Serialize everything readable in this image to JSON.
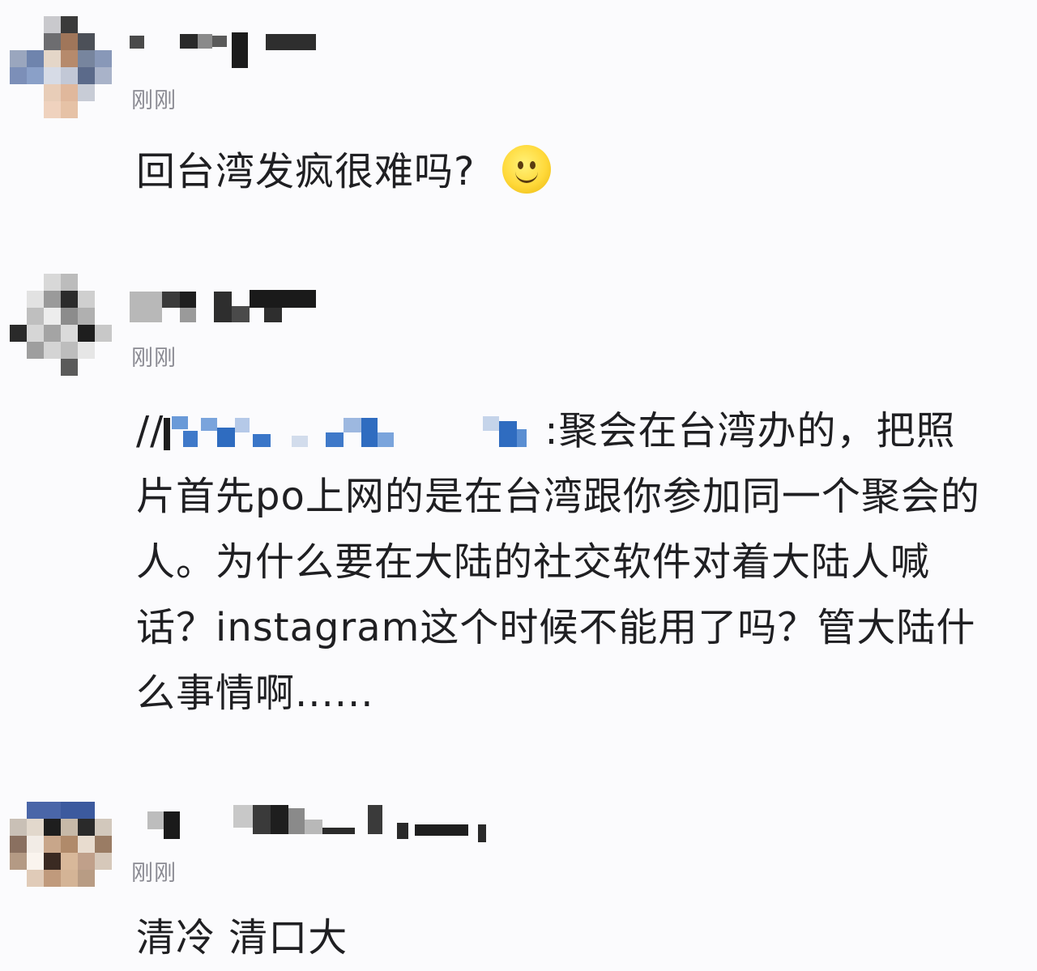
{
  "comments": [
    {
      "time": "刚刚",
      "text": "回台湾发疯很难吗?",
      "emoji": "smiley-emoji"
    },
    {
      "time": "刚刚",
      "mention_prefix": "//",
      "text": ":聚会在台湾办的，把照片首先po上网的是在台湾跟你参加同一个聚会的人。为什么要在大陆的社交软件对着大陆人喊话？instagram这个时候不能用了吗？管大陆什么事情啊......"
    },
    {
      "time": "刚刚",
      "text": "清冷 清口大"
    }
  ],
  "colors": {
    "background": "#fbfbfd",
    "text": "#1f1f22",
    "time": "#8a8a92",
    "mention_blue": "#3d7bd0"
  }
}
